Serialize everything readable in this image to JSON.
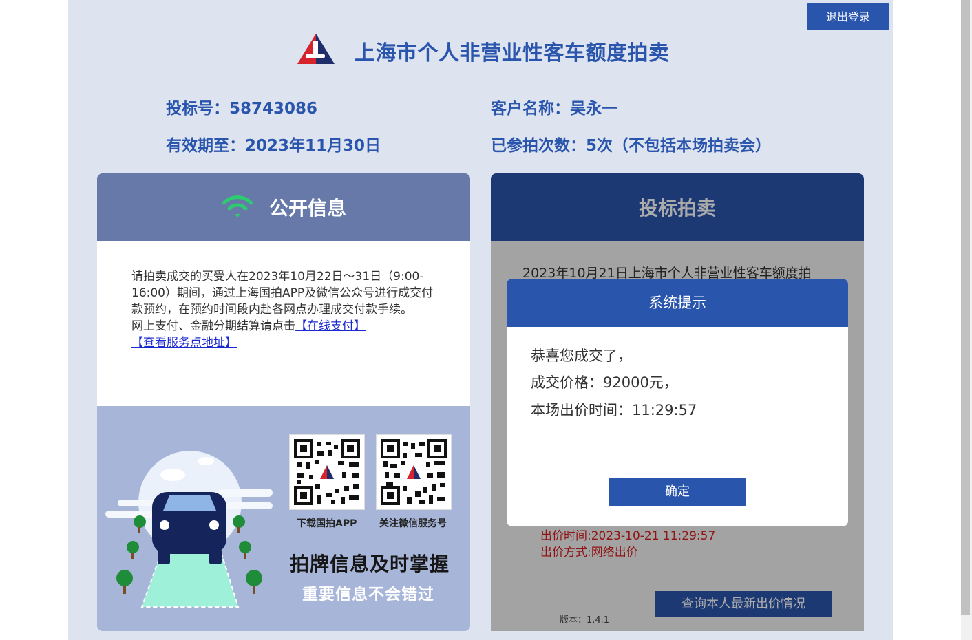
{
  "header": {
    "logout_label": "退出登录",
    "title": "上海市个人非营业性客车额度拍卖"
  },
  "info": {
    "bid_number": "投标号：58743086",
    "customer_name": "客户名称：吴永一",
    "valid_until": "有效期至：2023年11月30日",
    "participation_count": "已参拍次数：5次（不包括本场拍卖会）"
  },
  "public_info": {
    "title": "公开信息",
    "notice_text": "请拍卖成交的买受人在2023年10月22日～31日（9:00-16:00）期间，通过上海国拍APP及微信公众号进行成交付款预约，在预约时间段内赴各网点办理成交付款手续。",
    "payment_prefix": "网上支付、金融分期结算请点击",
    "online_pay_link": "【在线支付】",
    "service_point_link": "【查看服务点地址】",
    "qr_app_label": "下载国拍APP",
    "qr_wechat_label": "关注微信服务号",
    "slogan_main": "拍牌信息及时掌握",
    "slogan_sub": "重要信息不会错过"
  },
  "bidding": {
    "title": "投标拍卖",
    "auction_text": "2023年10月21日上海市个人非营业性客车额度拍",
    "bid_time": "出价时间:2023-10-21 11:29:57",
    "bid_method": "出价方式:网络出价",
    "version": "版本：1.4.1",
    "query_button": "查询本人最新出价情况"
  },
  "modal": {
    "title": "系统提示",
    "line1": "恭喜您成交了，",
    "line2": "成交价格：92000元，",
    "line3": "本场出价时间：11:29:57",
    "ok_label": "确定"
  },
  "colors": {
    "brand_blue": "#2a55ad",
    "page_bg": "#dde3ef",
    "alert_red": "#d42020",
    "wifi_green": "#2ecc71"
  },
  "icons": {
    "logo": "auction-logo-icon",
    "public_info": "wifi-icon",
    "qr": "qr-code-icon",
    "illustration": "car-illustration-icon"
  }
}
